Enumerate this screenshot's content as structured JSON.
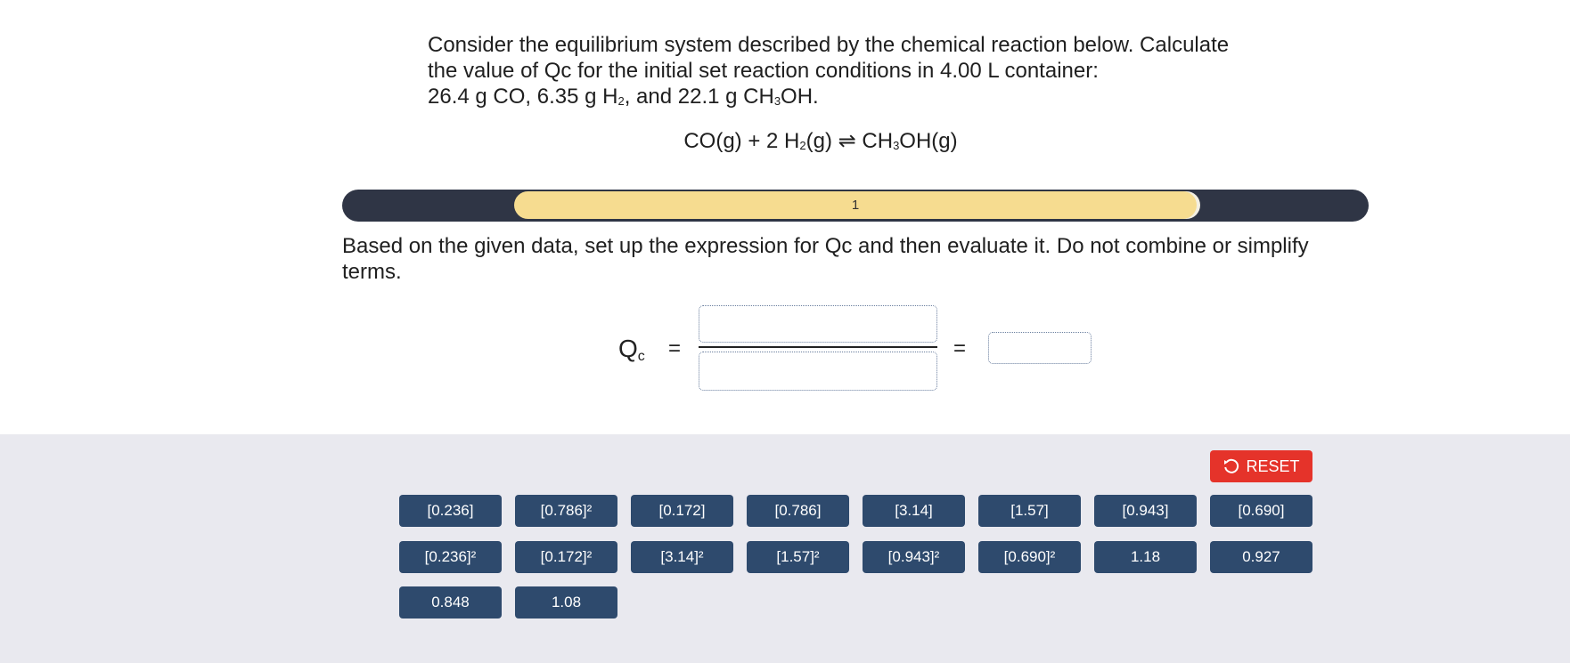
{
  "question": {
    "line1": "Consider the equilibrium system described by the chemical reaction below. Calculate",
    "line2": "the value of Qc for the initial set reaction conditions in 4.00 L container:",
    "line3_a": "26.4 g CO, 6.35 g H",
    "line3_sub1": "2",
    "line3_b": ", and 22.1 g CH",
    "line3_sub2": "3",
    "line3_c": "OH."
  },
  "reaction": {
    "part1": "CO(g) + 2 H",
    "sub1": "2",
    "part2": "(g) ⇌ CH",
    "sub2": "3",
    "part3": "OH(g)"
  },
  "progress": {
    "label": "1",
    "fill_fraction": 0.665
  },
  "instruction": "Based on the given data, set up the expression for Qc and then evaluate it. Do not combine or simplify terms.",
  "expression": {
    "q_label": "Q",
    "q_sub": "c",
    "equals": "="
  },
  "tray": {
    "reset_label": "RESET",
    "reset_icon": "undo-icon",
    "tiles": [
      "[0.236]",
      "[0.786]²",
      "[0.172]",
      "[0.786]",
      "[3.14]",
      "[1.57]",
      "[0.943]",
      "[0.690]",
      "[0.236]²",
      "[0.172]²",
      "[3.14]²",
      "[1.57]²",
      "[0.943]²",
      "[0.690]²",
      "1.18",
      "0.927",
      "0.848",
      "1.08"
    ]
  },
  "colors": {
    "tile": "#2e4a6d",
    "reset": "#e5332a",
    "progress_track": "#2f3545",
    "progress_fill": "#f6dc90",
    "tray_bg": "#e9e9ef"
  }
}
